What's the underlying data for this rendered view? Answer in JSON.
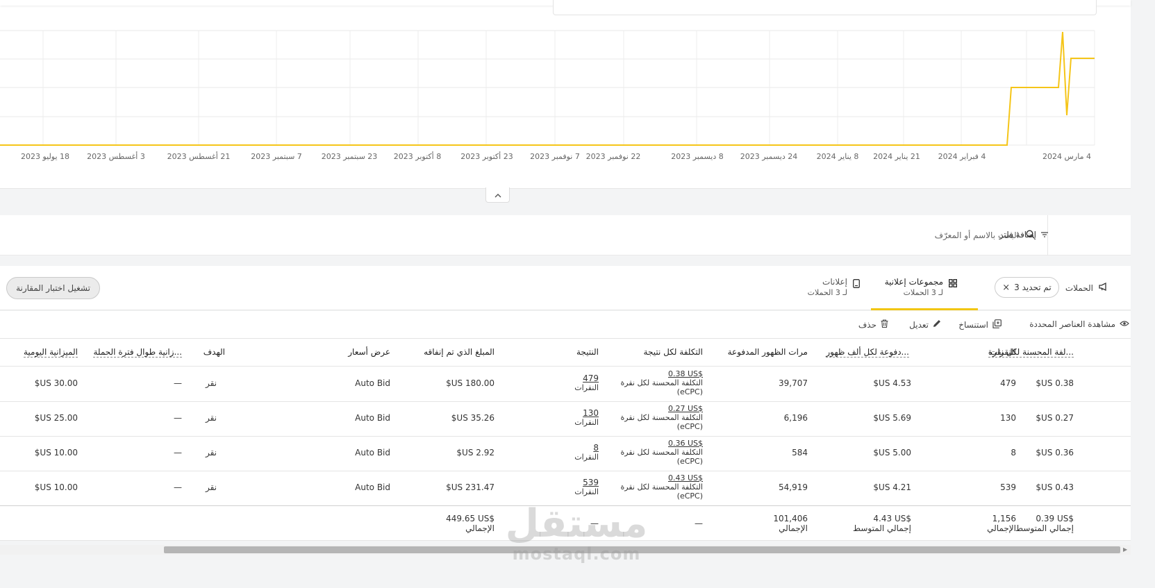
{
  "colors": {
    "accent": "#f2c613",
    "line": "#f5c518"
  },
  "chart": {
    "x_labels": [
      "4 مارس 2024",
      "4 فبراير 2024",
      "21 يناير 2024",
      "8 يناير 2024",
      "24 ديسمبر 2023",
      "8 ديسمبر 2023",
      "22 نوفمبر 2023",
      "7 نوفمبر 2023",
      "23 أكتوبر 2023",
      "8 أكتوبر 2023",
      "23 سبتمبر 2023",
      "7 سبتمبر 2023",
      "21 أغسطس 2023",
      "3 أغسطس 2023",
      "18 يوليو 2023"
    ]
  },
  "chart_data": {
    "type": "line",
    "grid": true,
    "x": [
      "18 يوليو 2023",
      "3 أغسطس 2023",
      "21 أغسطس 2023",
      "7 سبتمبر 2023",
      "23 سبتمبر 2023",
      "8 أكتوبر 2023",
      "23 أكتوبر 2023",
      "7 نوفمبر 2023",
      "22 نوفمبر 2023",
      "8 ديسمبر 2023",
      "24 ديسمبر 2023",
      "8 يناير 2024",
      "21 يناير 2024",
      "4 فبراير 2024",
      "4 مارس 2024"
    ],
    "series": [
      {
        "values": [
          0,
          0,
          0,
          0,
          0,
          0,
          0,
          0,
          0,
          0,
          0,
          0,
          0,
          0,
          3
        ]
      }
    ]
  },
  "filter": {
    "add_filter": "إضافة فلتر",
    "search_placeholder": "البحث بالاسم أو المعرّف"
  },
  "tabs": {
    "campaigns": "الحملات",
    "selected_chip": "تم تحديد 3",
    "adgroups_title": "مجموعات إعلانية",
    "adgroups_sub": "لـ 3 الحملات",
    "ads_title": "إعلانات",
    "ads_sub": "لـ 3 الحملات",
    "compare": "تشغيل اختبار المقارنة"
  },
  "actions": {
    "view_selected": "مشاهدة العناصر المحددة",
    "duplicate": "استنساخ",
    "edit": "تعديل",
    "delete": "حذف"
  },
  "table": {
    "headers": {
      "ecpc": "...لفة المحسنة لكل نقرة",
      "clicks": "النقرات",
      "cpm": "...دفوعة لكل ألف ظهور",
      "impressions": "مرات الظهور المدفوعة",
      "cpr": "التكلفة لكل نتيجة",
      "result": "النتيجة",
      "spent": "المبلغ الذي تم إنفاقه",
      "bid": "عرض أسعار",
      "goal": "الهدف",
      "lifetime_budget": "...زانية طوال فترة الحملة",
      "daily_budget": "الميزانية اليومية"
    },
    "rows": [
      {
        "ecpc": "0.38 US$",
        "clicks": "479",
        "cpm": "4.53 US$",
        "impressions": "39,707",
        "cpr_value": "0.38 US$",
        "cpr_label": "التكلفة المحسنة لكل نقرة (eCPC)",
        "result_value": "479",
        "result_label": "النقرات",
        "spent": "180.00 US$",
        "bid": "Auto Bid",
        "goal": "نقر",
        "lifetime": "—",
        "daily": "30.00 US$"
      },
      {
        "ecpc": "0.27 US$",
        "clicks": "130",
        "cpm": "5.69 US$",
        "impressions": "6,196",
        "cpr_value": "0.27 US$",
        "cpr_label": "التكلفة المحسنة لكل نقرة (eCPC)",
        "result_value": "130",
        "result_label": "النقرات",
        "spent": "35.26 US$",
        "bid": "Auto Bid",
        "goal": "نقر",
        "lifetime": "—",
        "daily": "25.00 US$"
      },
      {
        "ecpc": "0.36 US$",
        "clicks": "8",
        "cpm": "5.00 US$",
        "impressions": "584",
        "cpr_value": "0.36 US$",
        "cpr_label": "التكلفة المحسنة لكل نقرة (eCPC)",
        "result_value": "8",
        "result_label": "النقرات",
        "spent": "2.92 US$",
        "bid": "Auto Bid",
        "goal": "نقر",
        "lifetime": "—",
        "daily": "10.00 US$"
      },
      {
        "ecpc": "0.43 US$",
        "clicks": "539",
        "cpm": "4.21 US$",
        "impressions": "54,919",
        "cpr_value": "0.43 US$",
        "cpr_label": "التكلفة المحسنة لكل نقرة (eCPC)",
        "result_value": "539",
        "result_label": "النقرات",
        "spent": "231.47 US$",
        "bid": "Auto Bid",
        "goal": "نقر",
        "lifetime": "—",
        "daily": "10.00 US$"
      }
    ],
    "totals": {
      "ecpc_value": "0.39 US$",
      "ecpc_label": "إجمالي المتوسط",
      "clicks_value": "1,156",
      "clicks_label": "الإجمالي",
      "cpm_value": "4.43 US$",
      "cpm_label": "إجمالي المتوسط",
      "impressions_value": "101,406",
      "impressions_label": "الإجمالي",
      "cpr": "—",
      "result": "—",
      "spent_value": "449.65 US$",
      "spent_label": "الإجمالي"
    }
  },
  "watermark": {
    "ar": "مستقل",
    "en": "mostaql.com"
  }
}
